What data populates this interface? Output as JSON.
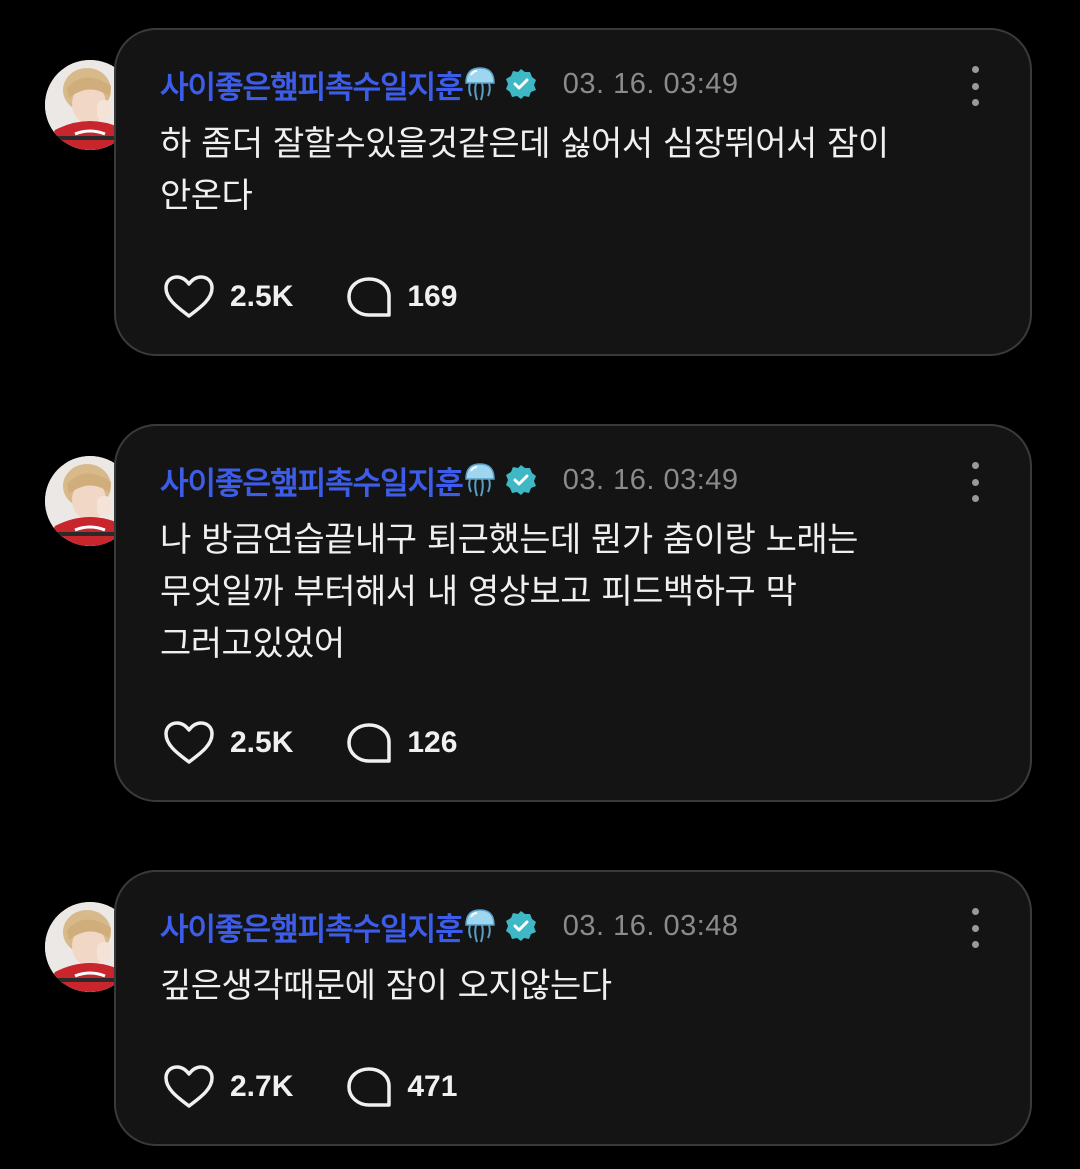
{
  "posts": [
    {
      "username": "사이좋은햎피촉수일지훈",
      "timestamp": "03. 16. 03:49",
      "lines": [
        "하 좀더 잘할수있을것같은데 싫어서 심장뛰어서 잠이",
        "안온다"
      ],
      "likes": "2.5K",
      "comments": "169"
    },
    {
      "username": "사이좋은햎피촉수일지훈",
      "timestamp": "03. 16. 03:49",
      "lines": [
        "나 방금연습끝내구 퇴근했는데 뭔가 춤이랑 노래는",
        "무엇일까 부터해서 내 영상보고 피드백하구 막",
        "그러고있었어"
      ],
      "likes": "2.5K",
      "comments": "126"
    },
    {
      "username": "사이좋은햎피촉수일지훈",
      "timestamp": "03. 16. 03:48",
      "lines": [
        "깊은생각때문에 잠이 오지않는다"
      ],
      "likes": "2.7K",
      "comments": "471"
    }
  ],
  "icons": {
    "username_badge": "jellyfish-emoji",
    "verified": "verified-check-icon",
    "more": "more-vertical-icon",
    "like": "heart-outline-icon",
    "comment": "speech-bubble-icon"
  },
  "colors": {
    "background": "#000000",
    "card": "#141414",
    "card_border": "#3a3a3a",
    "username": "#3d5de8",
    "verified": "#3fb8c6",
    "timestamp": "#8b8b8b",
    "text": "#f0f0f0"
  }
}
